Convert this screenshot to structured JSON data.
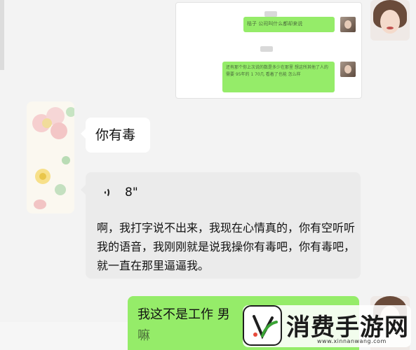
{
  "embedded_chat": {
    "message_1": "桔子 公司叫什么都却来说",
    "message_2": "还有那个你上次说的数是多少在那里 想这所其他了人的需要 95年的 1 70几 看着了也能 怎么样"
  },
  "messages": {
    "received_text": "你有毒",
    "voice": {
      "duration": "8\"",
      "transcript": "啊，我打字说不出来，我现在心情真的，你有空听听我的语音，我刚刚就是说我操你有毒吧，你有毒吧，就一直在那里逼逼我。"
    },
    "sent_text": "我这不是工作 男",
    "sent_text_line2": "嘛"
  },
  "watermark": {
    "title": "消费手游网",
    "url": "www.xinnanwang.com"
  },
  "colors": {
    "background": "#f3f3f3",
    "sent_bubble": "#95ec69",
    "received_bubble": "#ffffff",
    "voice_bubble": "#ebebeb"
  }
}
